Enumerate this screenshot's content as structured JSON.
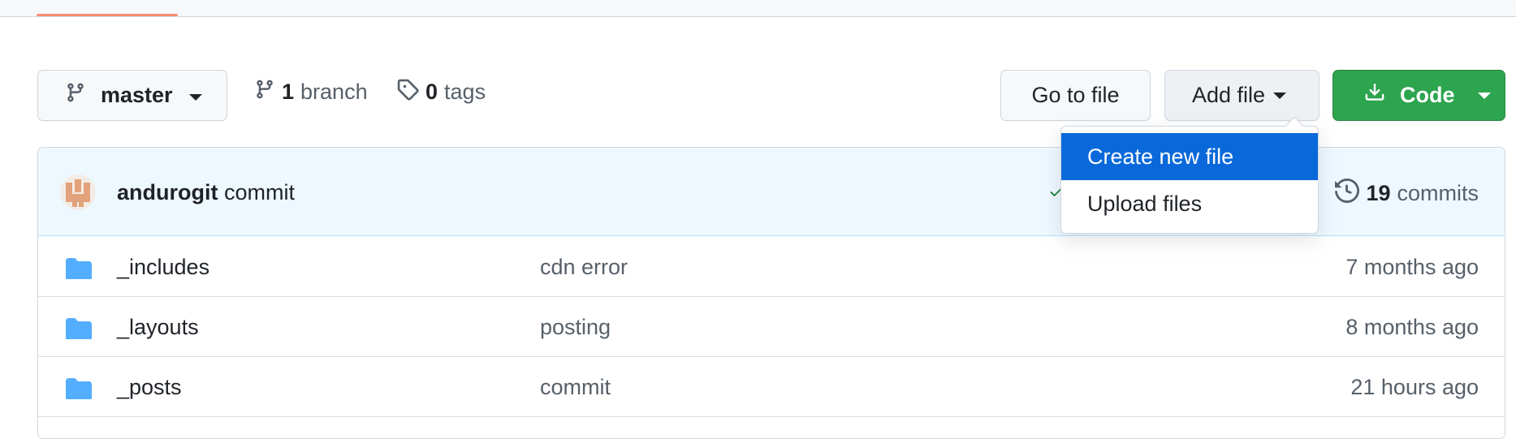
{
  "toolbar": {
    "branch_name": "master",
    "branch_count": "1",
    "branch_label": "branch",
    "tag_count": "0",
    "tag_label": "tags",
    "goto_file_label": "Go to file",
    "add_file_label": "Add file",
    "code_label": "Code"
  },
  "add_file_menu": {
    "items": [
      {
        "label": "Create new file",
        "active": true
      },
      {
        "label": "Upload files",
        "active": false
      }
    ]
  },
  "latest_commit": {
    "author": "andurogit",
    "message": "commit",
    "commit_count": "19",
    "commit_label": "commits"
  },
  "files": [
    {
      "name": "_includes",
      "message": "cdn error",
      "age": "7 months ago",
      "icon": "folder-icon"
    },
    {
      "name": "_layouts",
      "message": "posting",
      "age": "8 months ago",
      "icon": "folder-icon"
    },
    {
      "name": "_posts",
      "message": "commit",
      "age": "21 hours ago",
      "icon": "folder-icon"
    }
  ],
  "colors": {
    "accent": "#0969da",
    "code_button": "#2da44e",
    "folder": "#54aeff",
    "tab_underline": "#fd8c73"
  }
}
